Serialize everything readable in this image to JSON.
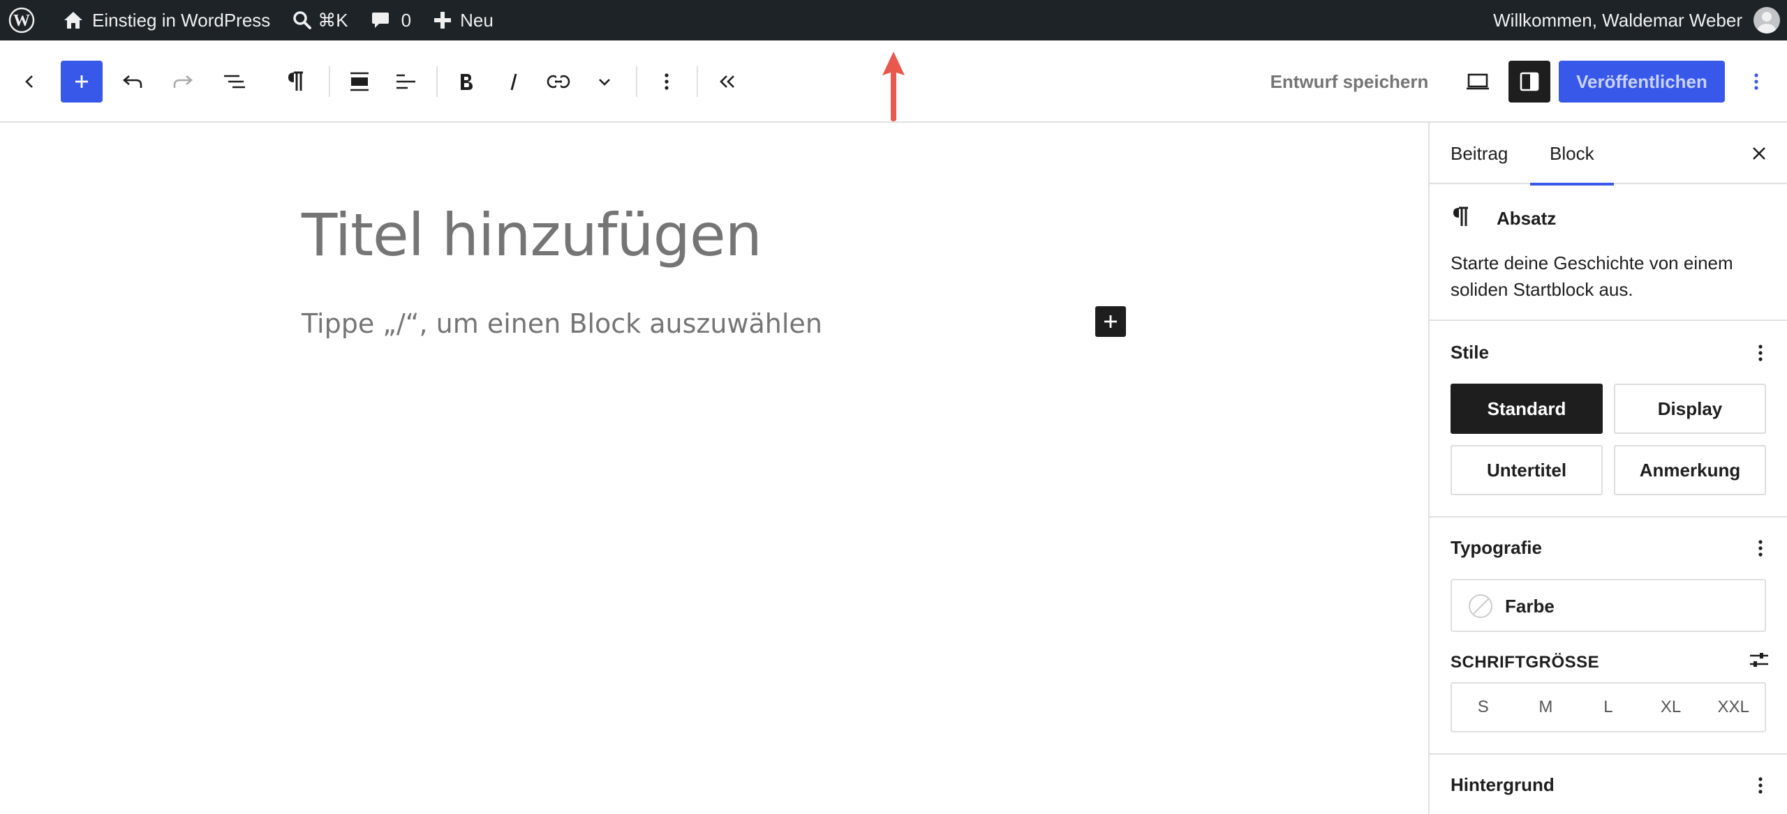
{
  "adminbar": {
    "site_name": "Einstieg in WordPress",
    "search_shortcut": "⌘K",
    "comments_count": "0",
    "new_label": "Neu",
    "greeting": "Willkommen, Waldemar Weber"
  },
  "toolbar": {
    "save_draft": "Entwurf speichern",
    "publish": "Veröffentlichen",
    "accent_color": "#3858e9"
  },
  "editor": {
    "title_placeholder": "Titel hinzufügen",
    "paragraph_placeholder": "Tippe „/“, um einen Block auszuwählen"
  },
  "sidebar": {
    "tabs": [
      {
        "label": "Beitrag"
      },
      {
        "label": "Block"
      }
    ],
    "block": {
      "name": "Absatz",
      "description": "Starte deine Geschichte von einem soliden Startblock aus."
    },
    "styles": {
      "heading": "Stile",
      "options": [
        "Standard",
        "Display",
        "Untertitel",
        "Anmerkung"
      ],
      "selected": "Standard"
    },
    "typography": {
      "heading": "Typografie",
      "color_label": "Farbe",
      "font_size_label": "SCHRIFTGRÖSSE",
      "sizes": [
        "S",
        "M",
        "L",
        "XL",
        "XXL"
      ]
    },
    "background": {
      "heading": "Hintergrund"
    }
  },
  "annotation": {
    "arrow_color": "#e8584d"
  }
}
